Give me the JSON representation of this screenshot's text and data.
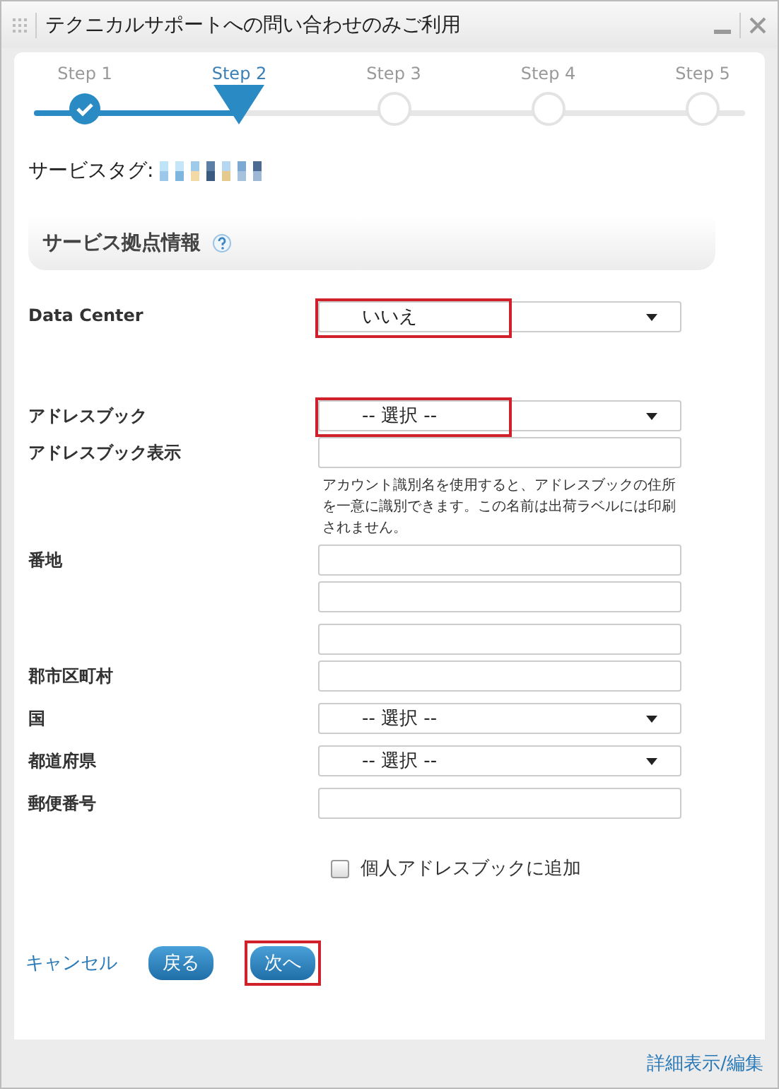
{
  "window": {
    "title": "テクニカルサポートへの問い合わせのみご利用"
  },
  "steps": [
    {
      "label": "Step 1",
      "completed": true,
      "selected": false
    },
    {
      "label": "Step 2",
      "completed": false,
      "selected": true
    },
    {
      "label": "Step 3",
      "completed": false,
      "selected": false
    },
    {
      "label": "Step 4",
      "completed": false,
      "selected": false
    },
    {
      "label": "Step 5",
      "completed": false,
      "selected": false
    }
  ],
  "service_tag": {
    "label": "サービスタグ:"
  },
  "section": {
    "title": "サービス拠点情報"
  },
  "rows": [
    {
      "label": "Data Center",
      "kind": "select",
      "value": "いいえ",
      "highlighted": true
    },
    {
      "label": "アドレスブック",
      "kind": "select",
      "value": "-- 選択 --",
      "highlighted": true
    },
    {
      "label": "アドレスブック表示",
      "kind": "input",
      "help": "アカウント識別名を使用すると、アドレスブックの住所を一意に識別できます。この名前は出荷ラベルには印刷されません。"
    },
    {
      "label": "番地",
      "kind": "input"
    },
    {
      "kind": "input"
    },
    {
      "kind": "input"
    },
    {
      "label": "郡市区町村",
      "kind": "input"
    },
    {
      "label": "国",
      "kind": "select",
      "value": "-- 選択 --",
      "highlighted": false
    },
    {
      "label": "都道府県",
      "kind": "select",
      "value": "-- 選択 --",
      "highlighted": false
    },
    {
      "label": "郵便番号",
      "kind": "input"
    }
  ],
  "checkbox": {
    "label": "個人アドレスブックに追加",
    "checked": false
  },
  "actions": {
    "cancel": "キャンセル",
    "back": {
      "label": "戻る",
      "highlighted": false
    },
    "next": {
      "label": "次へ",
      "highlighted": true
    }
  },
  "footer": {
    "link": "詳細表示/編集"
  }
}
